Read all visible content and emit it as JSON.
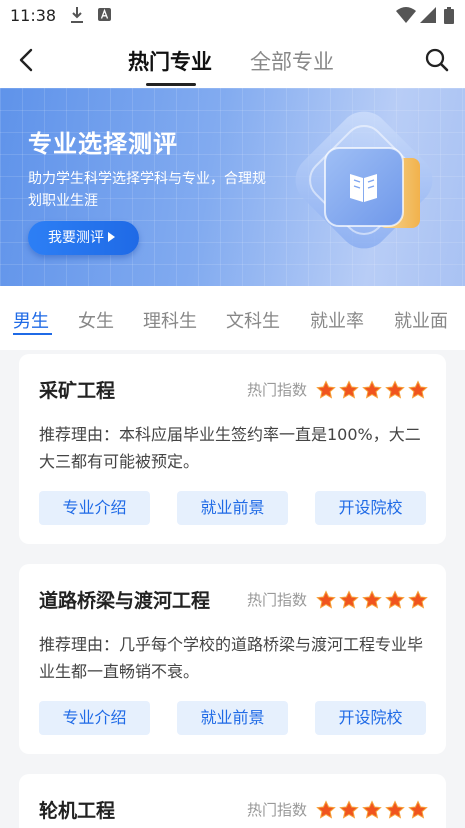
{
  "status_bar": {
    "time": "11:38"
  },
  "nav": {
    "tabs": [
      {
        "label": "热门专业",
        "active": true
      },
      {
        "label": "全部专业",
        "active": false
      }
    ]
  },
  "banner": {
    "title": "专业选择测评",
    "description": "助力学生科学选择学科与专业，合理规划职业生涯",
    "button_label": "我要测评"
  },
  "category_tabs": [
    "男生",
    "女生",
    "理科生",
    "文科生",
    "就业率",
    "就业面"
  ],
  "active_category": "男生",
  "cards": [
    {
      "title": "采矿工程",
      "rating_label": "热门指数",
      "rating": 5,
      "reason": "推荐理由：本科应届毕业生签约率一直是100%，大二大三都有可能被预定。",
      "buttons": [
        "专业介绍",
        "就业前景",
        "开设院校"
      ]
    },
    {
      "title": "道路桥梁与渡河工程",
      "rating_label": "热门指数",
      "rating": 5,
      "reason": "推荐理由：几乎每个学校的道路桥梁与渡河工程专业毕业生都一直畅销不衰。",
      "buttons": [
        "专业介绍",
        "就业前景",
        "开设院校"
      ]
    },
    {
      "title": "轮机工程",
      "rating_label": "热门指数",
      "rating": 5
    }
  ],
  "colors": {
    "accent": "#1f6ae6",
    "button_bg": "#e6f0fd",
    "star": "#f0541e"
  }
}
